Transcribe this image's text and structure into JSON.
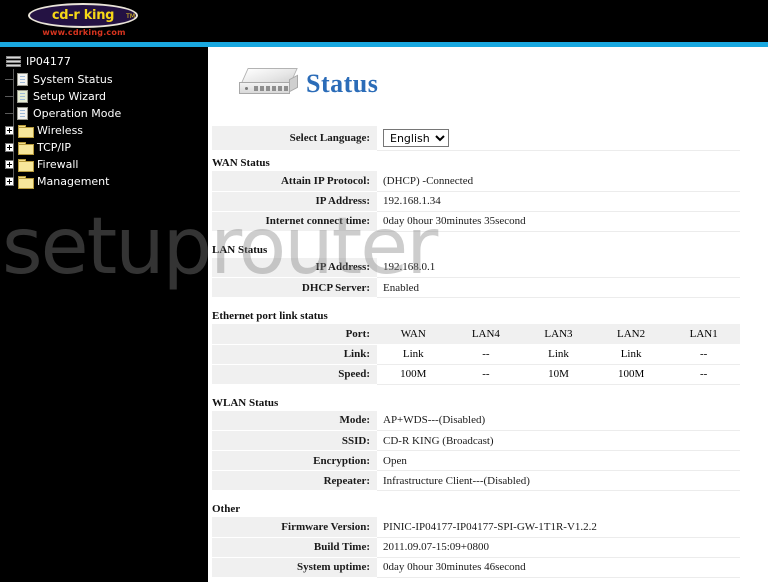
{
  "brand": {
    "name": "cd-r king",
    "tm": "TM",
    "url": "www.cdrking.com"
  },
  "watermark": "setuprouter",
  "sidebar": {
    "root": {
      "label": "IP04177",
      "icon": "device-icon"
    },
    "items": [
      {
        "label": "System Status",
        "icon": "page-icon",
        "type": "page"
      },
      {
        "label": "Setup Wizard",
        "icon": "page-icon",
        "type": "page"
      },
      {
        "label": "Operation Mode",
        "icon": "page-icon",
        "type": "page"
      },
      {
        "label": "Wireless",
        "icon": "folder-icon",
        "type": "folder",
        "expander": "plus-icon"
      },
      {
        "label": "TCP/IP",
        "icon": "folder-icon",
        "type": "folder",
        "expander": "plus-icon"
      },
      {
        "label": "Firewall",
        "icon": "folder-icon",
        "type": "folder",
        "expander": "plus-icon"
      },
      {
        "label": "Management",
        "icon": "folder-icon",
        "type": "folder",
        "expander": "plus-icon"
      }
    ]
  },
  "header": {
    "title": "Status",
    "icon": "router-icon",
    "title_color": "#2b6cb8"
  },
  "language": {
    "label": "Select Language:",
    "selected": "English",
    "options": [
      "English"
    ]
  },
  "wan": {
    "title": "WAN Status",
    "rows": [
      {
        "label": "Attain IP Protocol:",
        "value": "(DHCP) -Connected"
      },
      {
        "label": "IP Address:",
        "value": "192.168.1.34"
      },
      {
        "label": "Internet connect time:",
        "value": "0day 0hour 30minutes 35second"
      }
    ]
  },
  "lan": {
    "title": "LAN Status",
    "rows": [
      {
        "label": "IP Address:",
        "value": "192.168.0.1"
      },
      {
        "label": "DHCP Server:",
        "value": "Enabled"
      }
    ]
  },
  "ethernet": {
    "title": "Ethernet port link status",
    "rows": [
      {
        "label": "Port:",
        "values": [
          "WAN",
          "LAN4",
          "LAN3",
          "LAN2",
          "LAN1"
        ]
      },
      {
        "label": "Link:",
        "values": [
          "Link",
          "--",
          "Link",
          "Link",
          "--"
        ]
      },
      {
        "label": "Speed:",
        "values": [
          "100M",
          "--",
          "10M",
          "100M",
          "--"
        ]
      }
    ]
  },
  "wlan": {
    "title": "WLAN Status",
    "rows": [
      {
        "label": "Mode:",
        "value": "AP+WDS---(Disabled)"
      },
      {
        "label": "SSID:",
        "value": "CD-R KING  (Broadcast)"
      },
      {
        "label": "Encryption:",
        "value": "Open"
      },
      {
        "label": "Repeater:",
        "value": "Infrastructure Client---(Disabled)"
      }
    ]
  },
  "other": {
    "title": "Other",
    "rows": [
      {
        "label": "Firmware Version:",
        "value": "PINIC-IP04177-IP04177-SPI-GW-1T1R-V1.2.2"
      },
      {
        "label": "Build Time:",
        "value": "2011.09.07-15:09+0800"
      },
      {
        "label": "System uptime:",
        "value": "0day 0hour 30minutes 46second"
      }
    ]
  }
}
